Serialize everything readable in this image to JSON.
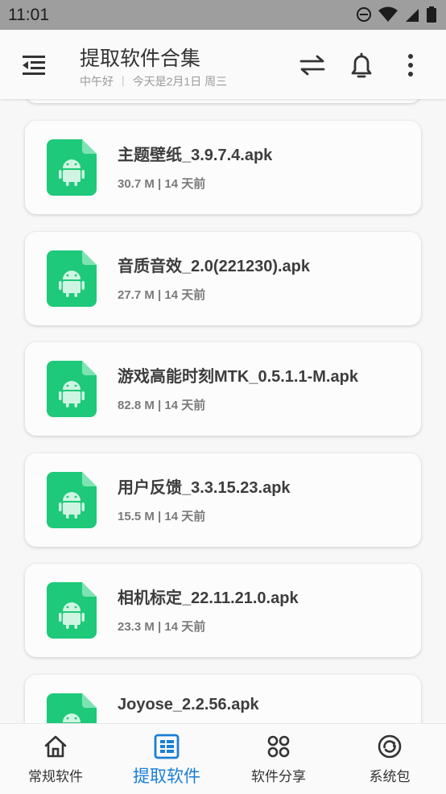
{
  "status_bar": {
    "time": "11:01",
    "icons": [
      "do-not-disturb-icon",
      "wifi-icon",
      "signal-icon",
      "battery-icon"
    ]
  },
  "app_bar": {
    "title": "提取软件合集",
    "greeting": "中午好",
    "date_text": "今天是2月1日 周三",
    "separator": "|",
    "actions": [
      "swap-icon",
      "bell-icon",
      "more-icon"
    ]
  },
  "files": [
    {
      "name": "主题壁纸_3.9.7.4.apk",
      "meta": "30.7 M | 14 天前"
    },
    {
      "name": "音质音效_2.0(221230).apk",
      "meta": "27.7 M | 14 天前"
    },
    {
      "name": "游戏高能时刻MTK_0.5.1.1-M.apk",
      "meta": "82.8 M | 14 天前"
    },
    {
      "name": "用户反馈_3.3.15.23.apk",
      "meta": "15.5 M | 14 天前"
    },
    {
      "name": "相机标定_22.11.21.0.apk",
      "meta": "23.3 M | 14 天前"
    },
    {
      "name": "Joyose_2.2.56.apk",
      "meta": ""
    }
  ],
  "bottom_nav": {
    "items": [
      {
        "label": "常规软件",
        "icon": "home-icon",
        "active": false
      },
      {
        "label": "提取软件",
        "icon": "list-icon",
        "active": true
      },
      {
        "label": "软件分享",
        "icon": "grid-icon",
        "active": false
      },
      {
        "label": "系统包",
        "icon": "refresh-icon",
        "active": false
      }
    ]
  },
  "colors": {
    "accent": "#1a7fd6",
    "apk_green": "#1ec97a",
    "status_bar": "#9e9e9e"
  }
}
